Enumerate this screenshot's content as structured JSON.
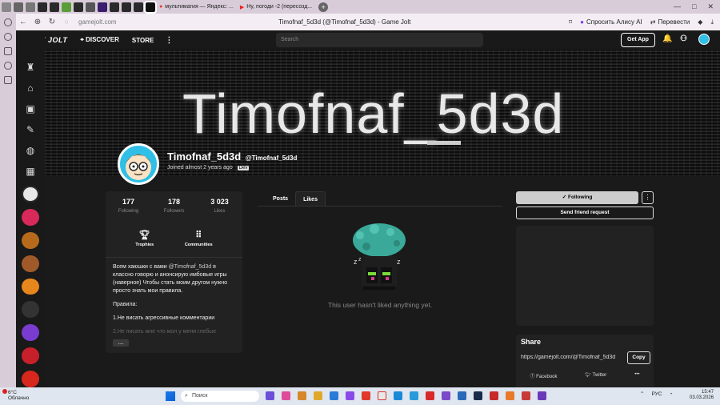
{
  "browser": {
    "tabs": [
      {
        "label": "мультимагия — Яндекс: ...",
        "active": false
      },
      {
        "label": "Ну, погоди -2 (пересозд...",
        "active": false
      }
    ],
    "url": "gamejolt.com",
    "page_title": "Timofnaf_5d3d (@Timofnaf_5d3d) - Game Jolt",
    "ask_alice": "Спросить Алису AI",
    "translate": "Перевести"
  },
  "gj": {
    "logo": "GAME JOLT",
    "nav": {
      "discover": "DISCOVER",
      "store": "STORE"
    },
    "search_placeholder": "Search",
    "get_app": "Get App"
  },
  "profile": {
    "banner_text": "Timofnaf_5d3d",
    "display_name": "Timofnaf_5d3d",
    "handle": "@Timofnaf_5d3d",
    "joined": "Joined almost 2 years ago",
    "badge": "Dev",
    "stats": [
      {
        "value": "177",
        "label": "Following"
      },
      {
        "value": "178",
        "label": "Followers"
      },
      {
        "value": "3 023",
        "label": "Likes"
      }
    ],
    "links": {
      "trophies": "Trophies",
      "communities": "Communities"
    },
    "bio": {
      "line1_pre": "Всем хаюшки с вами ",
      "line1_mention": "@Timofnaf_5d3d",
      "line1_post": " я классно говорю и анонсирую имбовые игры (наверное) Чтобы стать моим другом нужно просто знать мои правила.",
      "rules_title": "Правила:",
      "rule1": "1.Не висать агрессивные комментарии",
      "rule2": "2.Не писать мне что мол у меня глебые"
    },
    "more_btn": "..."
  },
  "content": {
    "tabs": {
      "posts": "Posts",
      "likes": "Likes"
    },
    "empty_message": "This user hasn't liked anything yet."
  },
  "sidebar": {
    "following": "Following",
    "send_friend_request": "Send friend request",
    "share_title": "Share",
    "share_url": "https://gamejolt.com/@Timofnaf_5d3d",
    "copy": "Copy",
    "facebook": "Facebook",
    "twitter": "Twitter"
  },
  "taskbar": {
    "weather_temp": "6°C",
    "weather_desc": "Облачно",
    "search": "Поиск",
    "lang": "РУС",
    "time": "15:47",
    "date": "03.03.2026"
  }
}
